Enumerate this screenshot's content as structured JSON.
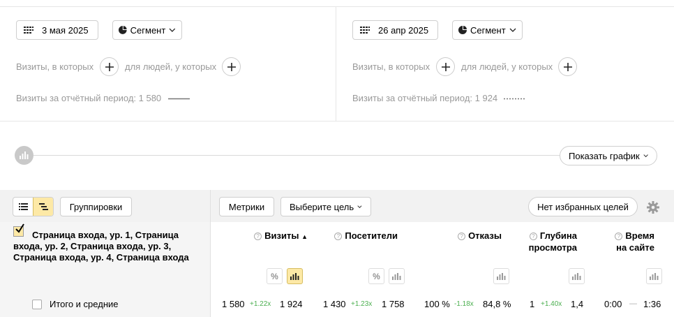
{
  "left_panel": {
    "date": "3 мая 2025",
    "segment": "Сегмент",
    "visits_where": "Визиты, в которых",
    "people_where": "для людей, у которых",
    "period_visits": "Визиты за отчётный период: 1 580"
  },
  "right_panel": {
    "date": "26 апр 2025",
    "segment": "Сегмент",
    "visits_where": "Визиты, в которых",
    "people_where": "для людей, у которых",
    "period_visits": "Визиты за отчётный период: 1 924"
  },
  "chart_toggle": {
    "label": "Показать график"
  },
  "toolbar": {
    "groupings": "Группировки",
    "metrics": "Метрики",
    "goal_select": "Выберите цель",
    "no_favorite_goals": "Нет избранных целей"
  },
  "table": {
    "dimension_header": "Страница входа, ур. 1, Страница входа, ур. 2, Страница входа, ур. 3, Страница входа, ур. 4, Страница входа",
    "columns": {
      "visits": "Визиты",
      "visitors": "Посетители",
      "bounces": "Отказы",
      "depth_line1": "Глубина",
      "depth_line2": "просмотра",
      "time_line1": "Время",
      "time_line2": "на сайте"
    },
    "sort_indicator": "▲",
    "percent_symbol": "%",
    "totals": {
      "label": "Итого и средние",
      "visits_a": "1 580",
      "visits_delta": "+1.22x",
      "visits_b": "1 924",
      "visitors_a": "1 430",
      "visitors_delta": "+1.23x",
      "visitors_b": "1 758",
      "bounces_a": "100 %",
      "bounces_delta": "-1.18x",
      "bounces_b": "84,8 %",
      "depth_a": "1",
      "depth_delta": "+1.40x",
      "depth_b": "1,4",
      "time_a": "0:00",
      "time_delta": "—",
      "time_b": "1:36"
    }
  },
  "colors": {
    "accent_yellow": "#fde9a6",
    "delta_green": "#4caf50",
    "muted_text": "#999999"
  }
}
